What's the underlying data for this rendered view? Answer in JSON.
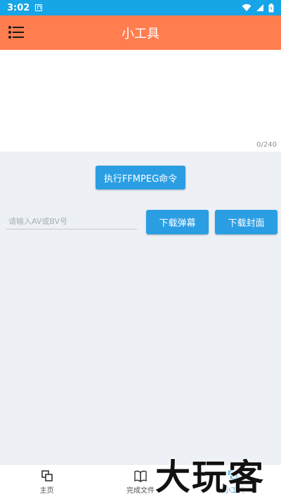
{
  "status_bar": {
    "time": "3:02",
    "icons": [
      "android-a-icon",
      "wifi-icon",
      "signal-icon",
      "battery-icon"
    ]
  },
  "app_bar": {
    "title": "小工具",
    "menu_icon": "menu-list-icon"
  },
  "command_input": {
    "value": "",
    "counter": "0/240"
  },
  "buttons": {
    "ffmpeg": "执行FFMPEG命令",
    "download_danmaku": "下载弹幕",
    "download_cover": "下载封面"
  },
  "av_input": {
    "placeholder": "请输入AV或BV号",
    "value": ""
  },
  "bottom_nav": {
    "items": [
      {
        "label": "主页",
        "icon": "home-icon",
        "active": false
      },
      {
        "label": "完成文件",
        "icon": "book-icon",
        "active": false
      },
      {
        "label": "小工具",
        "icon": "tools-icon",
        "active": true
      }
    ]
  },
  "watermark": "大玩客",
  "colors": {
    "status_bar": "#16a5e6",
    "app_bar": "#ff7d4f",
    "button": "#2b9ee3",
    "background": "#edf1f6"
  }
}
